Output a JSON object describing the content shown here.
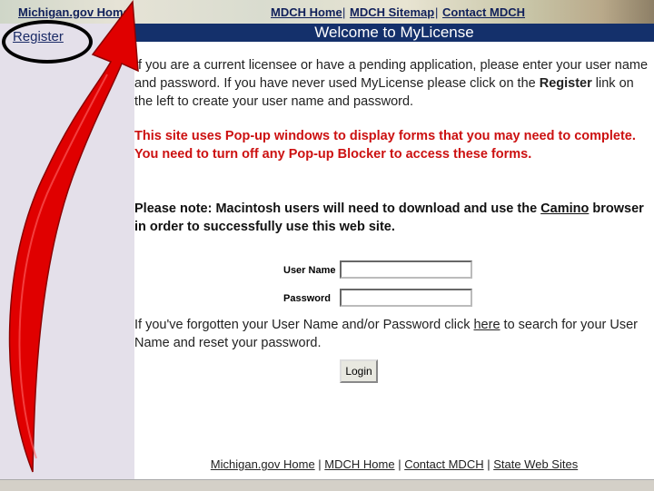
{
  "topnav": {
    "michigan_home": "Michigan.gov Home",
    "mdch_home": "MDCH Home",
    "sep1": "|",
    "mdch_sitemap": "MDCH Sitemap",
    "sep2": "|",
    "contact_mdch": "Contact MDCH"
  },
  "sidebar": {
    "register": "Register"
  },
  "banner": {
    "title": "Welcome to MyLicense"
  },
  "intro": {
    "text_before": "If you are a current licensee or have a pending application, please enter your user name and password. If you have never used MyLicense please click on the ",
    "register_link": "Register",
    "text_after": " link on the left to create your user name and password."
  },
  "popup_notice": "This site uses Pop-up windows to display forms that you may need to complete. You need to turn off any Pop-up Blocker to access these forms.",
  "mac_notice": {
    "text_before": "Please note: Macintosh users will need to download and use the ",
    "camino_link": "Camino",
    "text_after": " browser in order to successfully use this web site."
  },
  "form": {
    "username_label": "User Name",
    "username_value": "",
    "password_label": "Password",
    "password_value": "",
    "login_button": "Login"
  },
  "forgot": {
    "text_before": "If you've forgotten your User Name and/or Password click ",
    "here_link": "here",
    "text_after": " to search for your User Name and reset your password."
  },
  "footer": {
    "michigan_home": "Michigan.gov Home",
    "sep1": " | ",
    "mdch_home": "MDCH Home",
    "sep2": " | ",
    "contact_mdch": "Contact MDCH",
    "sep3": " | ",
    "state_web_sites": "State Web Sites"
  },
  "colors": {
    "banner_bg": "#14306b",
    "popup_text": "#cc1111",
    "sidebar_bg": "#e4e0ea",
    "annotation_arrow": "#e00000"
  },
  "icons": {
    "annotation": "red-curved-arrow-icon",
    "circle": "black-ellipse-highlight"
  }
}
